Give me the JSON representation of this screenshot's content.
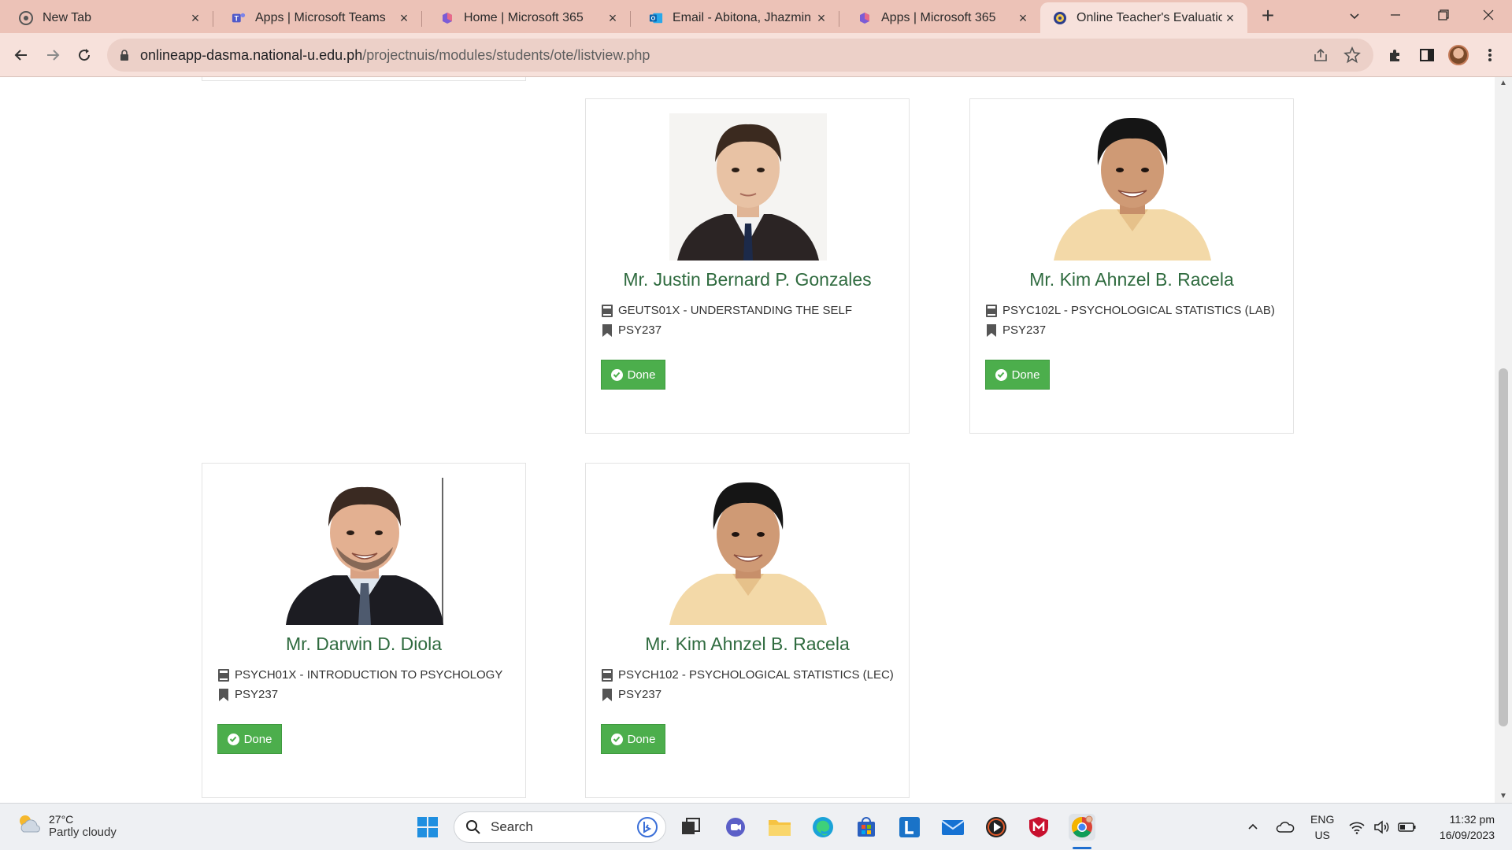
{
  "browser": {
    "tabs": [
      {
        "title": "New Tab",
        "icon": "chrome-icon",
        "active": false
      },
      {
        "title": "Apps | Microsoft Teams",
        "icon": "teams-icon",
        "active": false
      },
      {
        "title": "Home | Microsoft 365",
        "icon": "m365-icon",
        "active": false
      },
      {
        "title": "Email - Abitona, Jhazmin P",
        "icon": "outlook-icon",
        "active": false
      },
      {
        "title": "Apps | Microsoft 365",
        "icon": "m365-icon",
        "active": false
      },
      {
        "title": "Online Teacher's Evaluation",
        "icon": "university-seal-icon",
        "active": true
      }
    ],
    "url_host": "onlineapp-dasma.national-u.edu.ph",
    "url_path": "/projectnuis/modules/students/ote/listview.php"
  },
  "teachers": [
    {
      "name": "Mr. Justin Bernard P. Gonzales",
      "subject": "GEUTS01X - UNDERSTANDING THE SELF",
      "section": "PSY237",
      "status": "Done",
      "photo": "suit-portrait"
    },
    {
      "name": "Mr. Kim Ahnzel B. Racela",
      "subject": "PSYC102L - PSYCHOLOGICAL STATISTICS (LAB)",
      "section": "PSY237",
      "status": "Done",
      "photo": "barong-portrait"
    },
    {
      "name": "Mr. Darwin D. Diola",
      "subject": "PSYCH01X - INTRODUCTION TO PSYCHOLOGY",
      "section": "PSY237",
      "status": "Done",
      "photo": "suit-portrait-2"
    },
    {
      "name": "Mr. Kim Ahnzel B. Racela",
      "subject": "PSYCH102 - PSYCHOLOGICAL STATISTICS (LEC)",
      "section": "PSY237",
      "status": "Done",
      "photo": "barong-portrait"
    }
  ],
  "taskbar": {
    "weather_temp": "27°C",
    "weather_condition": "Partly cloudy",
    "search_placeholder": "Search",
    "lang_primary": "ENG",
    "lang_secondary": "US",
    "time": "11:32 pm",
    "date": "16/09/2023"
  },
  "colors": {
    "tab_strip": "#ecc2b7",
    "toolbar": "#f7e1db",
    "teacher_name": "#2f6b3f",
    "done_button": "#4cae4c"
  }
}
